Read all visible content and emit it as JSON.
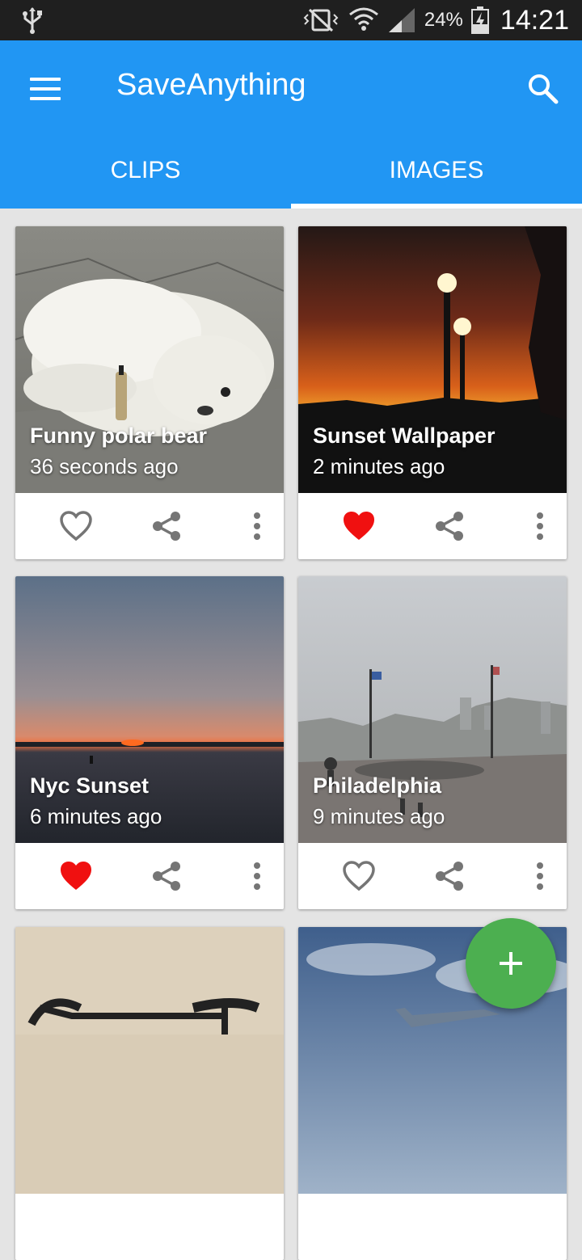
{
  "status_bar": {
    "battery_percent": "24%",
    "time": "14:21",
    "icons": [
      "usb-icon",
      "vibrate-icon",
      "wifi-icon",
      "signal-icon",
      "battery-charging-icon"
    ]
  },
  "app_bar": {
    "title": "SaveAnything",
    "menu_icon": "hamburger-menu-icon",
    "search_icon": "search-icon",
    "color": "#2196f3"
  },
  "tabs": [
    {
      "label": "CLIPS",
      "active": false
    },
    {
      "label": "IMAGES",
      "active": true
    }
  ],
  "cards": [
    {
      "title": "Funny polar bear",
      "time": "36 seconds ago",
      "liked": false
    },
    {
      "title": "Sunset Wallpaper",
      "time": "2 minutes ago",
      "liked": true
    },
    {
      "title": "Nyc Sunset",
      "time": "6 minutes ago",
      "liked": true
    },
    {
      "title": "Philadelphia",
      "time": "9 minutes ago",
      "liked": false
    },
    {
      "title": "",
      "time": "",
      "liked": false
    },
    {
      "title": "",
      "time": "",
      "liked": false
    }
  ],
  "fab": {
    "icon": "add-icon",
    "color": "#4caf50"
  },
  "like_color": "#f01010"
}
